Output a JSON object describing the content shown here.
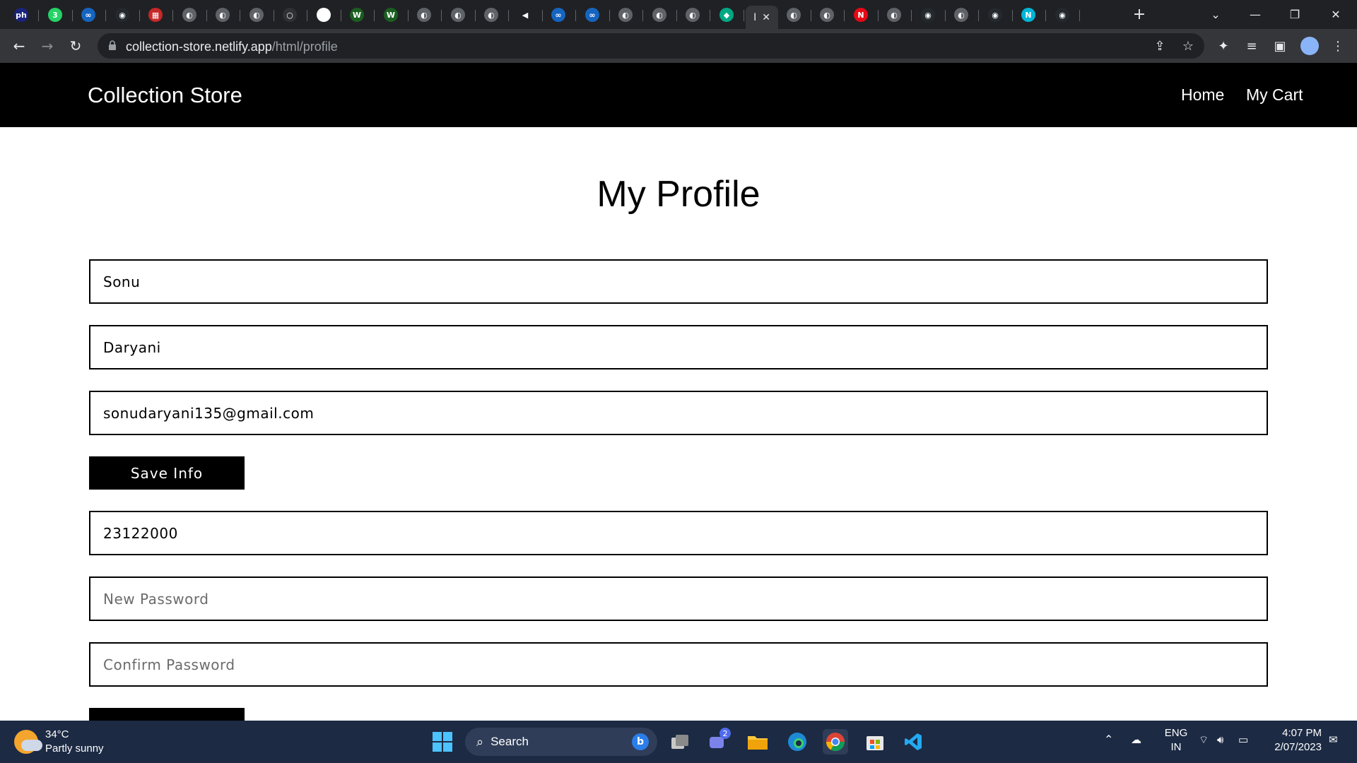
{
  "browser": {
    "tabs": [
      {
        "icon": "ph-icon",
        "glyph": "ph",
        "color": "#1a237e"
      },
      {
        "icon": "whatsapp-icon",
        "glyph": "3",
        "color": "#25d366"
      },
      {
        "icon": "infinity-icon",
        "glyph": "∞",
        "color": "#1565c0"
      },
      {
        "icon": "github-icon",
        "glyph": "◉",
        "color": "#24292e"
      },
      {
        "icon": "calendar-icon",
        "glyph": "▦",
        "color": "#c62828"
      },
      {
        "icon": "globe-icon",
        "glyph": "◐",
        "color": "#5f6368"
      },
      {
        "icon": "globe-icon",
        "glyph": "◐",
        "color": "#5f6368"
      },
      {
        "icon": "globe-icon",
        "glyph": "◐",
        "color": "#5f6368"
      },
      {
        "icon": "blank-icon",
        "glyph": "○",
        "color": "#303134"
      },
      {
        "icon": "google-icon",
        "glyph": "G",
        "color": "#ffffff"
      },
      {
        "icon": "w-icon",
        "glyph": "W",
        "color": "#1b5e20"
      },
      {
        "icon": "w-icon",
        "glyph": "W",
        "color": "#1b5e20"
      },
      {
        "icon": "globe-icon",
        "glyph": "◐",
        "color": "#5f6368"
      },
      {
        "icon": "globe-icon",
        "glyph": "◐",
        "color": "#5f6368"
      },
      {
        "icon": "globe-icon",
        "glyph": "◐",
        "color": "#5f6368"
      },
      {
        "icon": "audio-icon",
        "glyph": "◀",
        "color": "#202124"
      },
      {
        "icon": "infinity-icon",
        "glyph": "∞",
        "color": "#1565c0"
      },
      {
        "icon": "infinity-icon",
        "glyph": "∞",
        "color": "#1565c0"
      },
      {
        "icon": "globe-icon",
        "glyph": "◐",
        "color": "#5f6368"
      },
      {
        "icon": "globe-icon",
        "glyph": "◐",
        "color": "#5f6368"
      },
      {
        "icon": "globe-icon",
        "glyph": "◐",
        "color": "#5f6368"
      },
      {
        "icon": "diamond-icon",
        "glyph": "◆",
        "color": "#00a884"
      }
    ],
    "active_tab_glyph": "I",
    "tabs_after": [
      {
        "icon": "globe-icon",
        "glyph": "◐",
        "color": "#5f6368"
      },
      {
        "icon": "globe-icon",
        "glyph": "◐",
        "color": "#5f6368"
      },
      {
        "icon": "netflix-icon",
        "glyph": "N",
        "color": "#e50914"
      },
      {
        "icon": "globe-icon",
        "glyph": "◐",
        "color": "#5f6368"
      },
      {
        "icon": "github-icon",
        "glyph": "◉",
        "color": "#24292e"
      },
      {
        "icon": "globe-icon",
        "glyph": "◐",
        "color": "#5f6368"
      },
      {
        "icon": "github-icon",
        "glyph": "◉",
        "color": "#24292e"
      },
      {
        "icon": "n-icon",
        "glyph": "N",
        "color": "#00b4d8"
      },
      {
        "icon": "github-icon",
        "glyph": "◉",
        "color": "#24292e"
      }
    ],
    "url_host": "collection-store.netlify.app",
    "url_path": "/html/profile"
  },
  "site": {
    "brand": "Collection Store",
    "nav": {
      "home": "Home",
      "cart": "My Cart"
    }
  },
  "profile": {
    "heading": "My Profile",
    "first_name": "Sonu",
    "last_name": "Daryani",
    "email": "sonudaryani135@gmail.com",
    "save_label": "Save Info",
    "current_password": "23122000",
    "new_password_placeholder": "New Password",
    "confirm_password_placeholder": "Confirm Password"
  },
  "taskbar": {
    "temperature": "34°C",
    "weather": "Partly sunny",
    "search": "Search",
    "teams_badge": "2",
    "language": "ENG",
    "region": "IN",
    "time": "4:07 PM",
    "date": "2/07/2023"
  }
}
